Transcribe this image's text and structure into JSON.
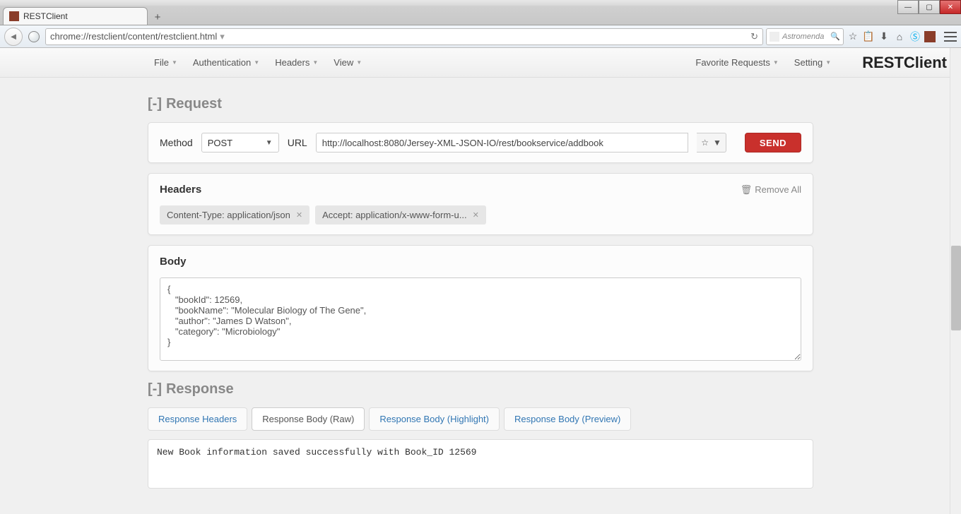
{
  "browser": {
    "tab_title": "RESTClient",
    "url": "chrome://restclient/content/restclient.html",
    "search_placeholder": "Astromenda"
  },
  "appbar": {
    "menus": [
      "File",
      "Authentication",
      "Headers",
      "View"
    ],
    "right_menus": [
      "Favorite Requests",
      "Setting"
    ],
    "title": "RESTClient"
  },
  "request": {
    "section_label": "Request",
    "method_label": "Method",
    "method_value": "POST",
    "url_label": "URL",
    "url_value": "http://localhost:8080/Jersey-XML-JSON-IO/rest/bookservice/addbook",
    "send_label": "SEND"
  },
  "headers": {
    "title": "Headers",
    "remove_all": "Remove All",
    "chips": [
      "Content-Type: application/json",
      "Accept: application/x-www-form-u..."
    ]
  },
  "body": {
    "title": "Body",
    "content": "{\n   \"bookId\": 12569,\n   \"bookName\": \"Molecular Biology of The Gene\",\n   \"author\": \"James D Watson\",\n   \"category\": \"Microbiology\"\n}"
  },
  "response": {
    "section_label": "Response",
    "tabs": [
      "Response Headers",
      "Response Body (Raw)",
      "Response Body (Highlight)",
      "Response Body (Preview)"
    ],
    "active_tab": 1,
    "body_text": "New Book information saved successfully with Book_ID 12569"
  }
}
